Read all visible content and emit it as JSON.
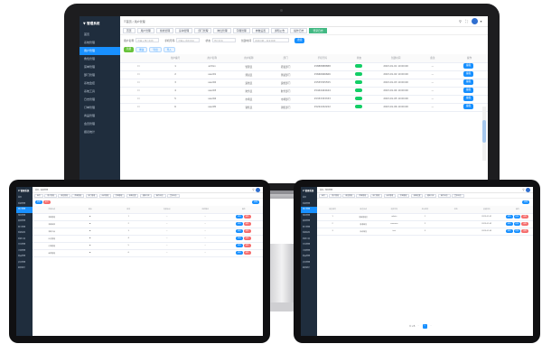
{
  "app": {
    "logo_text": "▼ 管理系统",
    "menu": [
      {
        "label": "首页",
        "active": false
      },
      {
        "label": "系统管理",
        "active": false
      },
      {
        "label": "用户管理",
        "active": true
      },
      {
        "label": "角色管理",
        "active": false
      },
      {
        "label": "菜单管理",
        "active": false
      },
      {
        "label": "部门管理",
        "active": false
      },
      {
        "label": "系统监控",
        "active": false
      },
      {
        "label": "系统工具",
        "active": false
      },
      {
        "label": "日志管理",
        "active": false
      },
      {
        "label": "订单管理",
        "active": false
      },
      {
        "label": "商品管理",
        "active": false
      },
      {
        "label": "会员管理",
        "active": false
      },
      {
        "label": "报表统计",
        "active": false
      }
    ]
  },
  "laptop": {
    "breadcrumb": "首页 / 用户管理",
    "tags": [
      "首页",
      "用户管理",
      "角色管理",
      "菜单管理",
      "部门管理",
      "岗位管理",
      "字典管理",
      "参数设置",
      "通知公告",
      "操作日志",
      "登录日志"
    ],
    "active_tag_index": 10,
    "filters": {
      "label_1": "用户名称",
      "placeholder_1": "请输入用户名称",
      "label_2": "手机号码",
      "placeholder_2": "请输入手机号码",
      "label_3": "状态",
      "placeholder_3": "用户状态",
      "label_4": "创建时间",
      "placeholder_4": "开始日期 - 结束日期",
      "search_label": "搜索"
    },
    "toolbar": {
      "add": "新增",
      "edit": "修改",
      "export": "导出",
      "import": "导入"
    },
    "columns": [
      "",
      "用户编号",
      "用户名称",
      "用户昵称",
      "部门",
      "手机号码",
      "状态",
      "创建时间",
      "备注",
      "操作"
    ],
    "rows": [
      [
        "1",
        "admin",
        "管理员",
        "研发部门",
        "15888888888",
        "2023-01-01 10:00:00",
        "—"
      ],
      [
        "2",
        "user01",
        "测试员",
        "测试部门",
        "15666666666",
        "2023-01-02 10:00:00",
        "—"
      ],
      [
        "3",
        "user02",
        "运维员",
        "运维部门",
        "15555555555",
        "2023-01-03 10:00:00",
        "—"
      ],
      [
        "4",
        "user03",
        "财务员",
        "财务部门",
        "15444444444",
        "2023-01-04 10:00:00",
        "—"
      ],
      [
        "5",
        "user04",
        "市场员",
        "市场部门",
        "15333333333",
        "2023-01-05 10:00:00",
        "—"
      ],
      [
        "6",
        "user05",
        "销售员",
        "销售部门",
        "15222222222",
        "2023-01-06 10:00:00",
        "—"
      ]
    ],
    "action_label": "编辑"
  },
  "tablet_left": {
    "breadcrumb": "首页 / 菜单管理",
    "tags": [
      "首页",
      "用户管理",
      "角色管理",
      "菜单管理",
      "部门管理",
      "岗位管理",
      "字典管理",
      "参数设置",
      "通知公告",
      "操作日志",
      "登录日志"
    ],
    "add_label": "新增",
    "expand_label": "展开",
    "new_label": "新增",
    "columns": [
      "菜单名称",
      "图标",
      "排序",
      "权限标识",
      "组件路径",
      "操作"
    ],
    "rows": [
      [
        "系统管理",
        "1",
        "—",
        "—"
      ],
      [
        "系统监控",
        "2",
        "—",
        "—"
      ],
      [
        "系统工具",
        "3",
        "—",
        "—"
      ],
      [
        "日志管理",
        "4",
        "—",
        "—"
      ],
      [
        "订单管理",
        "5",
        "—",
        "—"
      ],
      [
        "商品管理",
        "6",
        "—",
        "—"
      ]
    ],
    "edit_label": "修改",
    "delete_label": "删除"
  },
  "tablet_right": {
    "breadcrumb": "首页 / 角色管理",
    "tags": [
      "首页",
      "用户管理",
      "角色管理",
      "菜单管理",
      "部门管理",
      "岗位管理",
      "字典管理",
      "参数设置",
      "通知公告",
      "操作日志",
      "登录日志"
    ],
    "add_label": "新增",
    "columns": [
      "角色编号",
      "角色名称",
      "权限字符",
      "显示顺序",
      "状态",
      "创建时间",
      "操作"
    ],
    "rows": [
      [
        "1",
        "超级管理员",
        "admin",
        "1",
        "2023-01-01"
      ],
      [
        "2",
        "普通角色",
        "common",
        "2",
        "2023-01-02"
      ],
      [
        "3",
        "测试角色",
        "test",
        "3",
        "2023-01-03"
      ]
    ],
    "edit_label": "修改",
    "delete_label": "删除",
    "perm_label": "权限",
    "pager": {
      "total": "共 3 条",
      "page": "1"
    }
  },
  "colors": {
    "sidebar": "#1f2d3d",
    "accent": "#1890ff",
    "success": "#67c23a",
    "danger": "#f56c6c",
    "tag_active": "#42b983"
  }
}
